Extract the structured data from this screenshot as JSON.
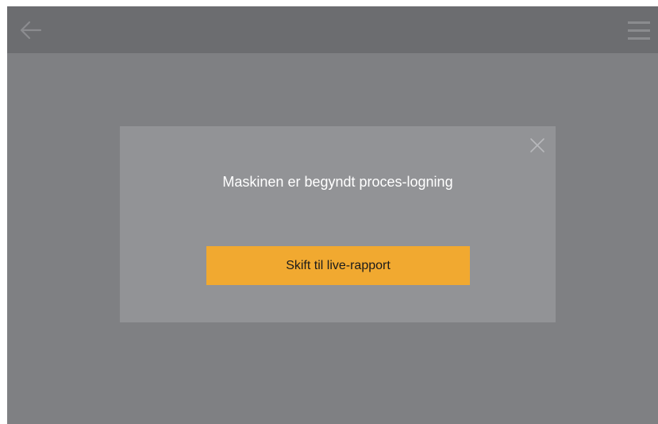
{
  "header": {
    "back_icon": "arrow-left-icon",
    "menu_icon": "hamburger-menu-icon"
  },
  "dialog": {
    "message": "Maskinen er begyndt proces-logning",
    "action_label": "Skift til live-rapport",
    "close_icon": "close-icon"
  },
  "colors": {
    "background": "#7f8083",
    "topbar": "#6c6d70",
    "dialog": "#929396",
    "accent": "#f1a930"
  }
}
